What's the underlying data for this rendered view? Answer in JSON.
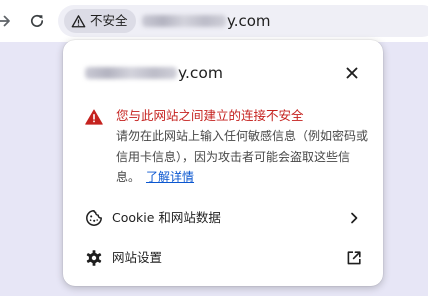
{
  "colors": {
    "page_background": "#e7e6f6",
    "toolbar": "#ffffff",
    "omnibox": "#efeff6",
    "chip": "#dcdce6",
    "warning_red": "#c5221f",
    "link_blue": "#0b57d0",
    "text_primary": "#1f1f1f",
    "text_secondary": "#474747"
  },
  "toolbar": {
    "forward_icon": "arrow-right-icon",
    "reload_icon": "reload-icon",
    "security_chip": {
      "icon": "warning-triangle-icon",
      "label": "不安全"
    },
    "url": {
      "visible_suffix": "y.com"
    }
  },
  "popup": {
    "site_domain_suffix": "y.com",
    "close_icon": "close-icon",
    "warning": {
      "icon": "warning-triangle-filled-icon",
      "title": "您与此网站之间建立的连接不安全",
      "description": "请勿在此网站上输入任何敏感信息（例如密码或信用卡信息），因为攻击者可能会盗取这些信息。",
      "learn_more": "了解详情"
    },
    "rows": [
      {
        "icon": "cookie-icon",
        "label": "Cookie 和网站数据",
        "trailing_icon": "chevron-right-icon"
      },
      {
        "icon": "gear-icon",
        "label": "网站设置",
        "trailing_icon": "open-external-icon"
      }
    ]
  }
}
